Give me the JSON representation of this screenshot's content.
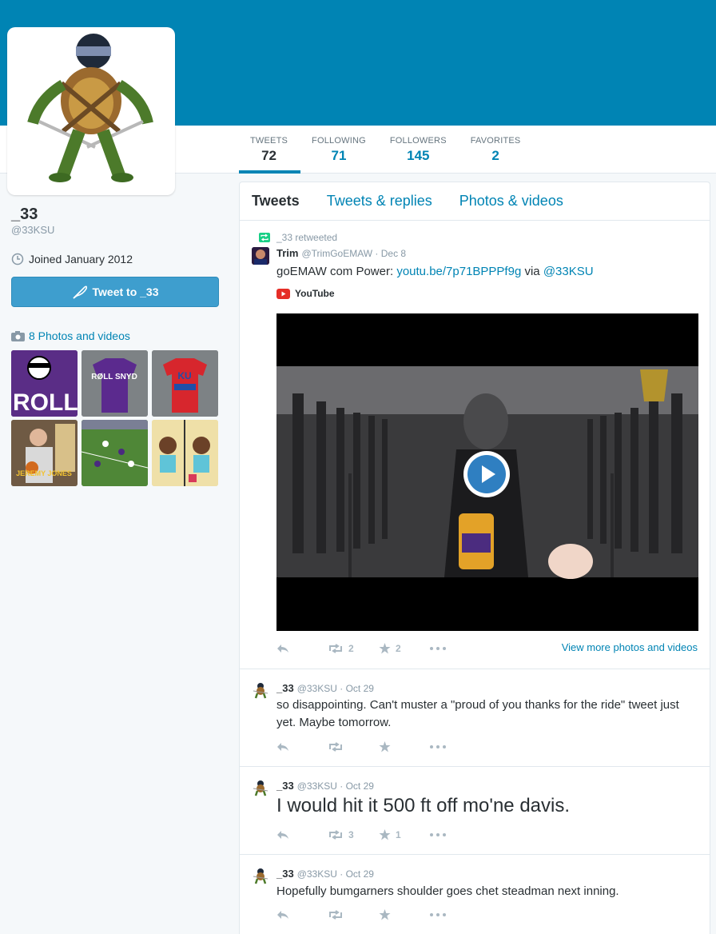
{
  "profile": {
    "name": "_33",
    "handle": "@33KSU",
    "joined": "Joined January 2012",
    "tweet_to_label": "Tweet to _33",
    "photos_link": "8 Photos and videos"
  },
  "stats": [
    {
      "label": "TWEETS",
      "value": "72"
    },
    {
      "label": "FOLLOWING",
      "value": "71"
    },
    {
      "label": "FOLLOWERS",
      "value": "145"
    },
    {
      "label": "FAVORITES",
      "value": "2"
    }
  ],
  "timeline_tabs": [
    "Tweets",
    "Tweets & replies",
    "Photos & videos"
  ],
  "thumb_texts": {
    "t1": "ROLL",
    "t2": "RØLL SNYD",
    "t3": "KU",
    "t4": "JEREMY JONES"
  },
  "tweets": [
    {
      "retweet_note": "_33 retweeted",
      "name": "Trim",
      "handle": "@TrimGoEMAW · Dec 8",
      "text_before": "goEMAW com Power: ",
      "link1": "youtu.be/7p71BPPPf9g",
      "text_mid": " via ",
      "link2": "@33KSU",
      "card_source": "YouTube",
      "retweets": "2",
      "favorites": "2",
      "view_more": "View more photos and videos"
    },
    {
      "name": "_33",
      "handle": "@33KSU · Oct 29",
      "text": "so disappointing.  Can't muster a \"proud of you thanks for the ride\" tweet just yet.  Maybe tomorrow."
    },
    {
      "name": "_33",
      "handle": "@33KSU · Oct 29",
      "text": "I would hit it 500 ft off mo'ne davis.",
      "retweets": "3",
      "favorites": "1"
    },
    {
      "name": "_33",
      "handle": "@33KSU · Oct 29",
      "text": "Hopefully bumgarners shoulder goes chet steadman next inning."
    }
  ],
  "colors": {
    "brand": "#0084b4",
    "button": "#3e9ece",
    "muted": "#8899a6",
    "retweet_green": "#19cf86"
  },
  "icons": [
    "clock-icon",
    "quill-icon",
    "camera-icon",
    "retweet-icon",
    "reply-icon",
    "star-icon",
    "more-icon",
    "youtube-icon",
    "play-icon"
  ]
}
